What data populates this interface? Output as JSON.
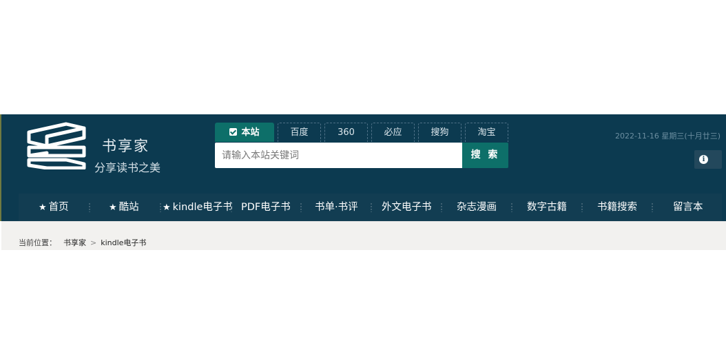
{
  "site": {
    "name": "书享家",
    "slogan": "分享读书之美"
  },
  "search": {
    "tabs": [
      {
        "label": "本站",
        "active": true
      },
      {
        "label": "百度",
        "active": false
      },
      {
        "label": "360",
        "active": false
      },
      {
        "label": "必应",
        "active": false
      },
      {
        "label": "搜狗",
        "active": false
      },
      {
        "label": "淘宝",
        "active": false
      }
    ],
    "placeholder": "请输入本站关键词",
    "button_label": "搜 索"
  },
  "header": {
    "date_text": "2022-11-16 星期三(十月廿三)",
    "info_icon": "info-circle-icon"
  },
  "nav": {
    "items": [
      {
        "label": "首页",
        "icon": "star-icon"
      },
      {
        "label": "酷站",
        "icon": "star-icon"
      },
      {
        "label": "kindle电子书",
        "icon": "star-icon"
      },
      {
        "label": "PDF电子书"
      },
      {
        "label": "书单·书评"
      },
      {
        "label": "外文电子书"
      },
      {
        "label": "杂志漫画"
      },
      {
        "label": "数字古籍"
      },
      {
        "label": "书籍搜索"
      },
      {
        "label": "留言本"
      }
    ]
  },
  "breadcrumb": {
    "prefix": "当前位置：",
    "home": "书享家",
    "separator": ">",
    "current": "kindle电子书"
  },
  "colors": {
    "header_bg": "#0c3a50",
    "nav_bg": "#123d52",
    "accent": "#0d6f69",
    "breadcrumb_bg": "#f2f1ef"
  }
}
